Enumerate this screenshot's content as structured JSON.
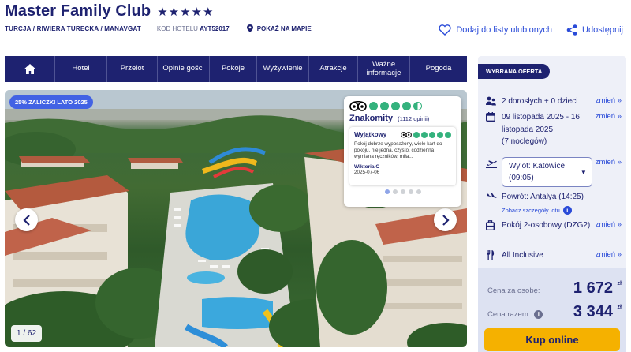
{
  "header": {
    "hotel_name": "Master Family Club",
    "stars": "★★★★★",
    "breadcrumb": "TURCJA / RIWIERA TURECKA / MANAVGAT",
    "hotel_code_label": "KOD HOTELU",
    "hotel_code": "AYT52017",
    "map_link": "POKAŻ NA MAPIE",
    "favorite_label": "Dodaj do listy ulubionych",
    "share_label": "Udostępnij"
  },
  "nav": {
    "items": [
      "Hotel",
      "Przelot",
      "Opinie gości",
      "Pokoje",
      "Wyżywienie",
      "Atrakcje",
      "Ważne informacje",
      "Pogoda"
    ]
  },
  "gallery": {
    "promo_badge": "25% ZALICZKI LATO 2025",
    "counter": "1 / 62",
    "review": {
      "rating_word": "Znakomity",
      "rating_count": "(1112 opinii)",
      "title": "Wyjątkowy",
      "text": "Pokój dobrze wyposażony, wiele kart do pokoju, nie jedna, czysto, codzienna wymiana ręczników, miła...",
      "author": "Wiktoria C",
      "date": "2025-07-06",
      "score_dots": 4.5
    }
  },
  "offer": {
    "tag": "WYBRANA OFERTA",
    "change_label": "zmień »",
    "travelers": "2 dorosłych + 0 dzieci",
    "dates": "09 listopada 2025 - 16 listopada 2025",
    "nights": "(7 nocleg­ów)",
    "departure": "Wylot: Katowice",
    "departure_time": "(09:05)",
    "return": "Powrót: Antalya (14:25)",
    "flight_details": "Zobacz szczegóły lotu",
    "room": "Pokój 2-osobowy (DZG2)",
    "board": "All Inclusive",
    "price_per_person_label": "Cena za osobę:",
    "price_per_person": "1 672",
    "price_total_label": "Cena razem:",
    "price_total": "3 344",
    "currency": "zł",
    "buy_label": "Kup online"
  },
  "colors": {
    "navy": "#1e2270",
    "link": "#2a4bd8",
    "tripadvisor_green": "#34b27d",
    "buy_button": "#f5b100"
  }
}
